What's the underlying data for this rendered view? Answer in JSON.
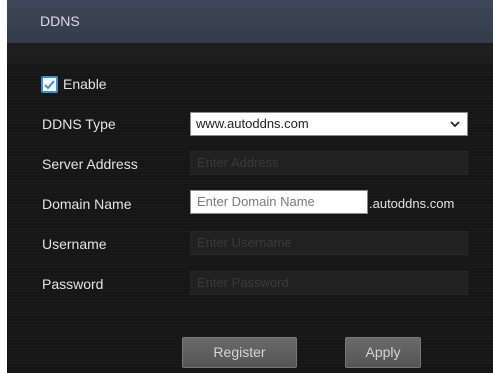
{
  "header": {
    "title": "DDNS"
  },
  "enable": {
    "label": "Enable",
    "checked": true
  },
  "form": {
    "ddns_type": {
      "label": "DDNS Type",
      "value": "www.autoddns.com"
    },
    "server_address": {
      "label": "Server Address",
      "placeholder": "Enter Address"
    },
    "domain_name": {
      "label": "Domain Name",
      "placeholder": "Enter Domain Name",
      "suffix": ".autoddns.com"
    },
    "username": {
      "label": "Username",
      "placeholder": "Enter Username"
    },
    "password": {
      "label": "Password",
      "placeholder": "Enter Password"
    }
  },
  "buttons": {
    "register": "Register",
    "apply": "Apply"
  },
  "colors": {
    "accent": "#3a8fd6",
    "header": "#3c4454",
    "background": "#161616"
  }
}
